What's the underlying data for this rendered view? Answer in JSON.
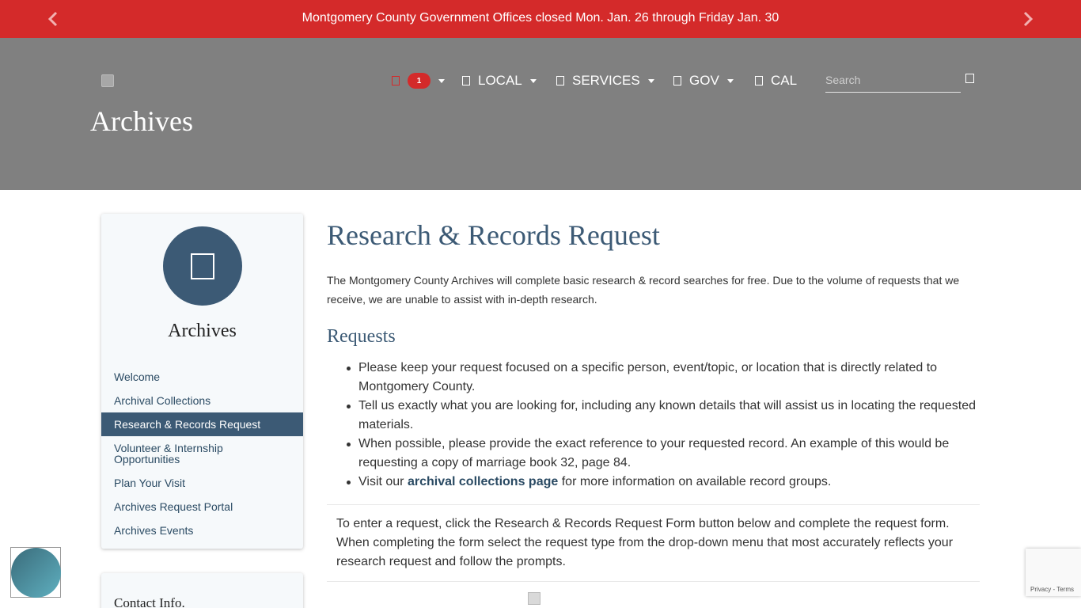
{
  "alert": {
    "text": "Montgomery County Government Offices closed Mon. Jan. 26 through Friday Jan. 30"
  },
  "header": {
    "page_title": "Archives",
    "alerts_badge": "1",
    "nav": [
      {
        "label": "LOCAL"
      },
      {
        "label": "SERVICES"
      },
      {
        "label": "GOV"
      },
      {
        "label": "CAL"
      }
    ],
    "search": {
      "placeholder": "Search",
      "value": ""
    }
  },
  "sidebar": {
    "title": "Archives",
    "items": [
      {
        "label": "Welcome"
      },
      {
        "label": "Archival Collections"
      },
      {
        "label": "Research & Records Request",
        "active": true
      },
      {
        "label": "Volunteer & Internship Opportunities"
      },
      {
        "label": "Plan Your Visit"
      },
      {
        "label": "Archives Request Portal"
      },
      {
        "label": "Archives Events"
      }
    ],
    "contact_title": "Contact Info."
  },
  "main": {
    "title": "Research & Records Request",
    "intro": "The Montgomery County Archives will complete basic research & record searches for free. Due to the volume of requests that we receive, we are unable to assist with in-depth research.",
    "requests_heading": "Requests",
    "requests": [
      "Please keep your request focused on a specific person, event/topic, or location that is directly related to Montgomery County.",
      "Tell us exactly what you are looking for, including any known details that will assist us in locating the requested materials.",
      "When possible, please provide the exact reference to your requested record. An example of this would be requesting a copy of marriage book 32, page 84."
    ],
    "visit_prefix": "Visit our",
    "visit_link": "archival collections page",
    "visit_suffix": "for more information on available record groups.",
    "enter_text": "To enter a request, click the Research & Records Request Form button below and complete the request form. When completing the form select the request type from the drop-down menu that most accurately reflects your research request and follow the prompts."
  },
  "recaptcha": {
    "privacy": "Privacy",
    "separator": "-",
    "terms": "Terms"
  },
  "colors": {
    "alert_red": "#d42a2a",
    "header_gray": "#808080",
    "accent_blue": "#3c5a75"
  }
}
